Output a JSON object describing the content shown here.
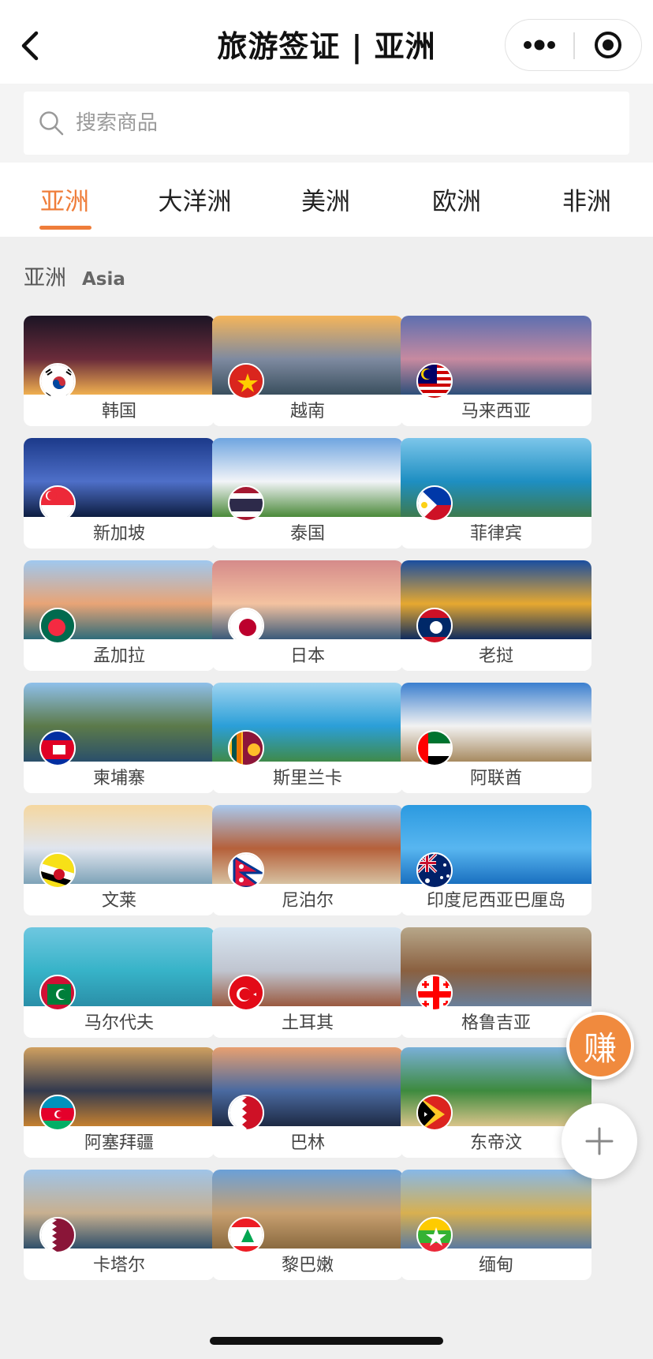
{
  "navbar": {
    "title": "旅游签证 | 亚洲",
    "back_icon": "chevron-left-icon",
    "more_icon": "more-dots-icon",
    "record_icon": "record-target-icon"
  },
  "search": {
    "placeholder": "搜索商品",
    "icon": "search-icon"
  },
  "tabs": [
    {
      "label": "亚洲",
      "active": true
    },
    {
      "label": "大洋洲",
      "active": false
    },
    {
      "label": "美洲",
      "active": false
    },
    {
      "label": "欧洲",
      "active": false
    },
    {
      "label": "非洲",
      "active": false
    }
  ],
  "section": {
    "title_zh": "亚洲",
    "title_en": "Asia"
  },
  "countries": [
    {
      "name": "韩国",
      "flag": "south-korea-flag-icon"
    },
    {
      "name": "越南",
      "flag": "vietnam-flag-icon"
    },
    {
      "name": "马来西亚",
      "flag": "malaysia-flag-icon"
    },
    {
      "name": "新加坡",
      "flag": "singapore-flag-icon"
    },
    {
      "name": "泰国",
      "flag": "thailand-flag-icon"
    },
    {
      "name": "菲律宾",
      "flag": "philippines-flag-icon"
    },
    {
      "name": "孟加拉",
      "flag": "bangladesh-flag-icon"
    },
    {
      "name": "日本",
      "flag": "japan-flag-icon"
    },
    {
      "name": "老挝",
      "flag": "laos-flag-icon"
    },
    {
      "name": "柬埔寨",
      "flag": "cambodia-flag-icon"
    },
    {
      "name": "斯里兰卡",
      "flag": "sri-lanka-flag-icon"
    },
    {
      "name": "阿联酋",
      "flag": "uae-flag-icon"
    },
    {
      "name": "文莱",
      "flag": "brunei-flag-icon"
    },
    {
      "name": "尼泊尔",
      "flag": "nepal-flag-icon"
    },
    {
      "name": "印度尼西亚巴厘岛",
      "flag": "australia-flag-icon"
    },
    {
      "name": "马尔代夫",
      "flag": "maldives-flag-icon"
    },
    {
      "name": "土耳其",
      "flag": "turkey-flag-icon"
    },
    {
      "name": "格鲁吉亚",
      "flag": "georgia-flag-icon"
    },
    {
      "name": "阿塞拜疆",
      "flag": "azerbaijan-flag-icon"
    },
    {
      "name": "巴林",
      "flag": "bahrain-flag-icon"
    },
    {
      "name": "东帝汶",
      "flag": "timor-leste-flag-icon"
    },
    {
      "name": "卡塔尔",
      "flag": "qatar-flag-icon"
    },
    {
      "name": "黎巴嫩",
      "flag": "lebanon-flag-icon"
    },
    {
      "name": "缅甸",
      "flag": "myanmar-flag-icon"
    }
  ],
  "floating": {
    "earn_label": "赚",
    "plus_icon": "plus-icon"
  },
  "colors": {
    "accent": "#ef7d3a",
    "earn_button": "#f08a3e",
    "background": "#efefef"
  }
}
